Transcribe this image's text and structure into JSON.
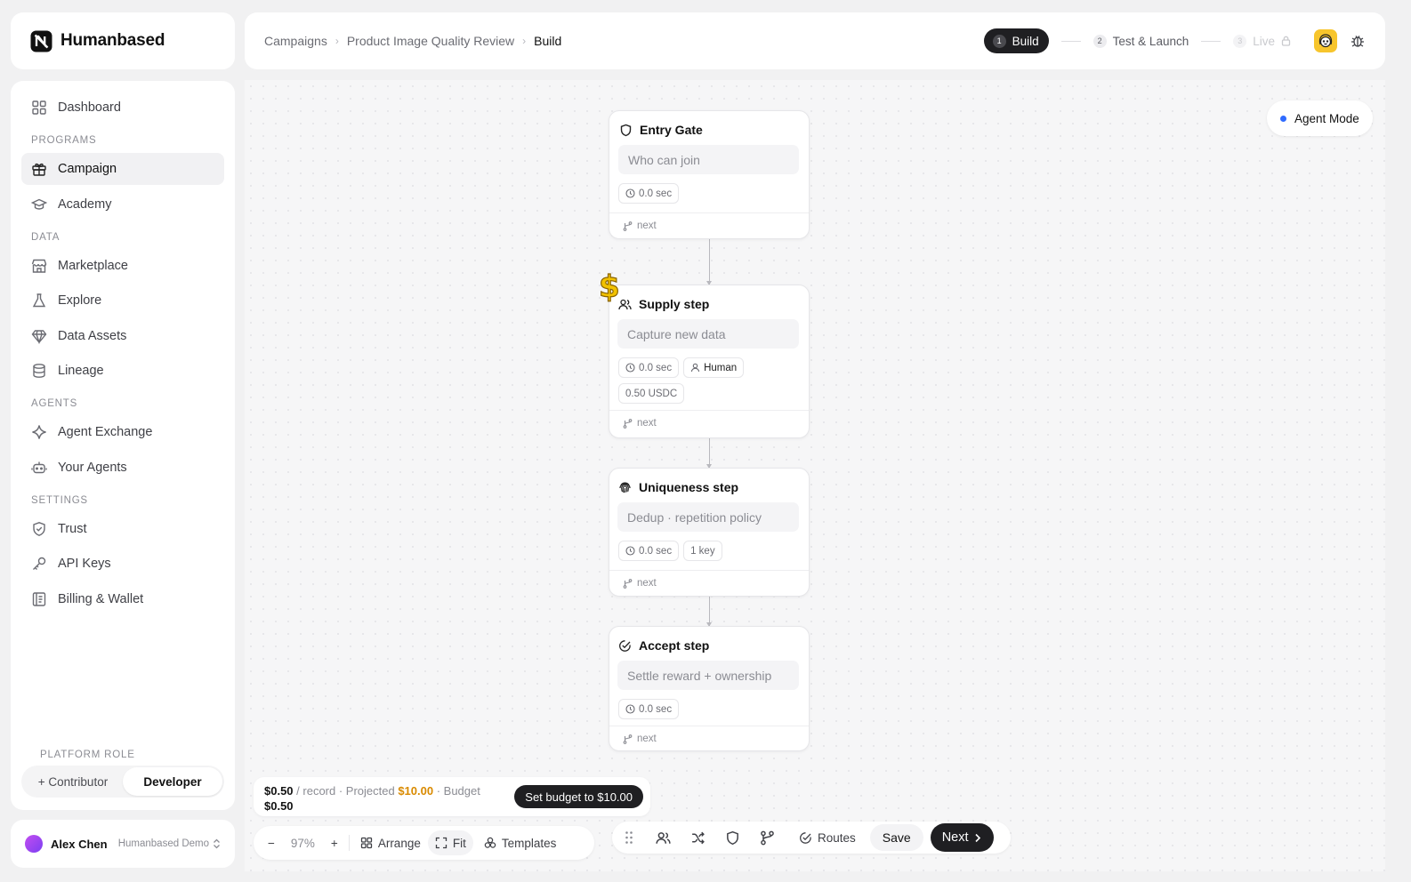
{
  "app": {
    "name": "Humanbased"
  },
  "breadcrumb": [
    "Campaigns",
    "Product Image Quality Review",
    "Build"
  ],
  "steps": [
    {
      "num": "1",
      "label": "Build",
      "state": "active"
    },
    {
      "num": "2",
      "label": "Test & Launch",
      "state": "upcoming"
    },
    {
      "num": "3",
      "label": "Live",
      "state": "locked"
    }
  ],
  "sidebar": {
    "dashboard": "Dashboard",
    "sections": {
      "programs": "PROGRAMS",
      "data": "DATA",
      "agents": "AGENTS",
      "settings": "SETTINGS"
    },
    "items": {
      "campaign": "Campaign",
      "academy": "Academy",
      "marketplace": "Marketplace",
      "explore": "Explore",
      "data_assets": "Data Assets",
      "lineage": "Lineage",
      "agent_exchange": "Agent Exchange",
      "your_agents": "Your Agents",
      "trust": "Trust",
      "api_keys": "API Keys",
      "billing": "Billing & Wallet"
    },
    "active_item": "Campaign",
    "role": {
      "label": "PLATFORM ROLE",
      "contributor": "+ Contributor",
      "developer": "Developer",
      "selected": "Developer"
    }
  },
  "user": {
    "name": "Alex Chen",
    "org": "Humanbased Demo"
  },
  "agent_mode": {
    "label": "Agent Mode",
    "color": "#2f6bff"
  },
  "nodes": [
    {
      "title": "Entry Gate",
      "icon": "shield-icon",
      "placeholder": "Who can join",
      "time": "0.0 sec",
      "next": "next"
    },
    {
      "title": "Supply step",
      "icon": "users-icon",
      "placeholder": "Capture new data",
      "time": "0.0 sec",
      "actor": "Human",
      "price": "0.50 USDC",
      "next": "next"
    },
    {
      "title": "Uniqueness step",
      "icon": "fingerprint-icon",
      "placeholder": "Dedup · repetition policy",
      "time": "0.0 sec",
      "keys": "1 key",
      "next": "next"
    },
    {
      "title": "Accept step",
      "icon": "check-circle-icon",
      "placeholder": "Settle reward + ownership",
      "time": "0.0 sec",
      "next": "next"
    }
  ],
  "budget": {
    "per_record": "$0.50",
    "per_record_suffix": " / record · Projected ",
    "projected": "$10.00",
    "budget_label": " · Budget",
    "budget_value": "$0.50",
    "set_button": "Set budget to $10.00",
    "projected_color": "#d98a00"
  },
  "zoom": {
    "minus": "−",
    "value": "97%",
    "plus": "+",
    "arrange": "Arrange",
    "fit": "Fit",
    "templates": "Templates"
  },
  "actions": {
    "routes": "Routes",
    "save": "Save",
    "next": "Next"
  },
  "decor": {
    "dollar": "$"
  },
  "colors": {
    "accent_dark": "#1f1f22",
    "brand_avatar": "#f7c52c"
  }
}
